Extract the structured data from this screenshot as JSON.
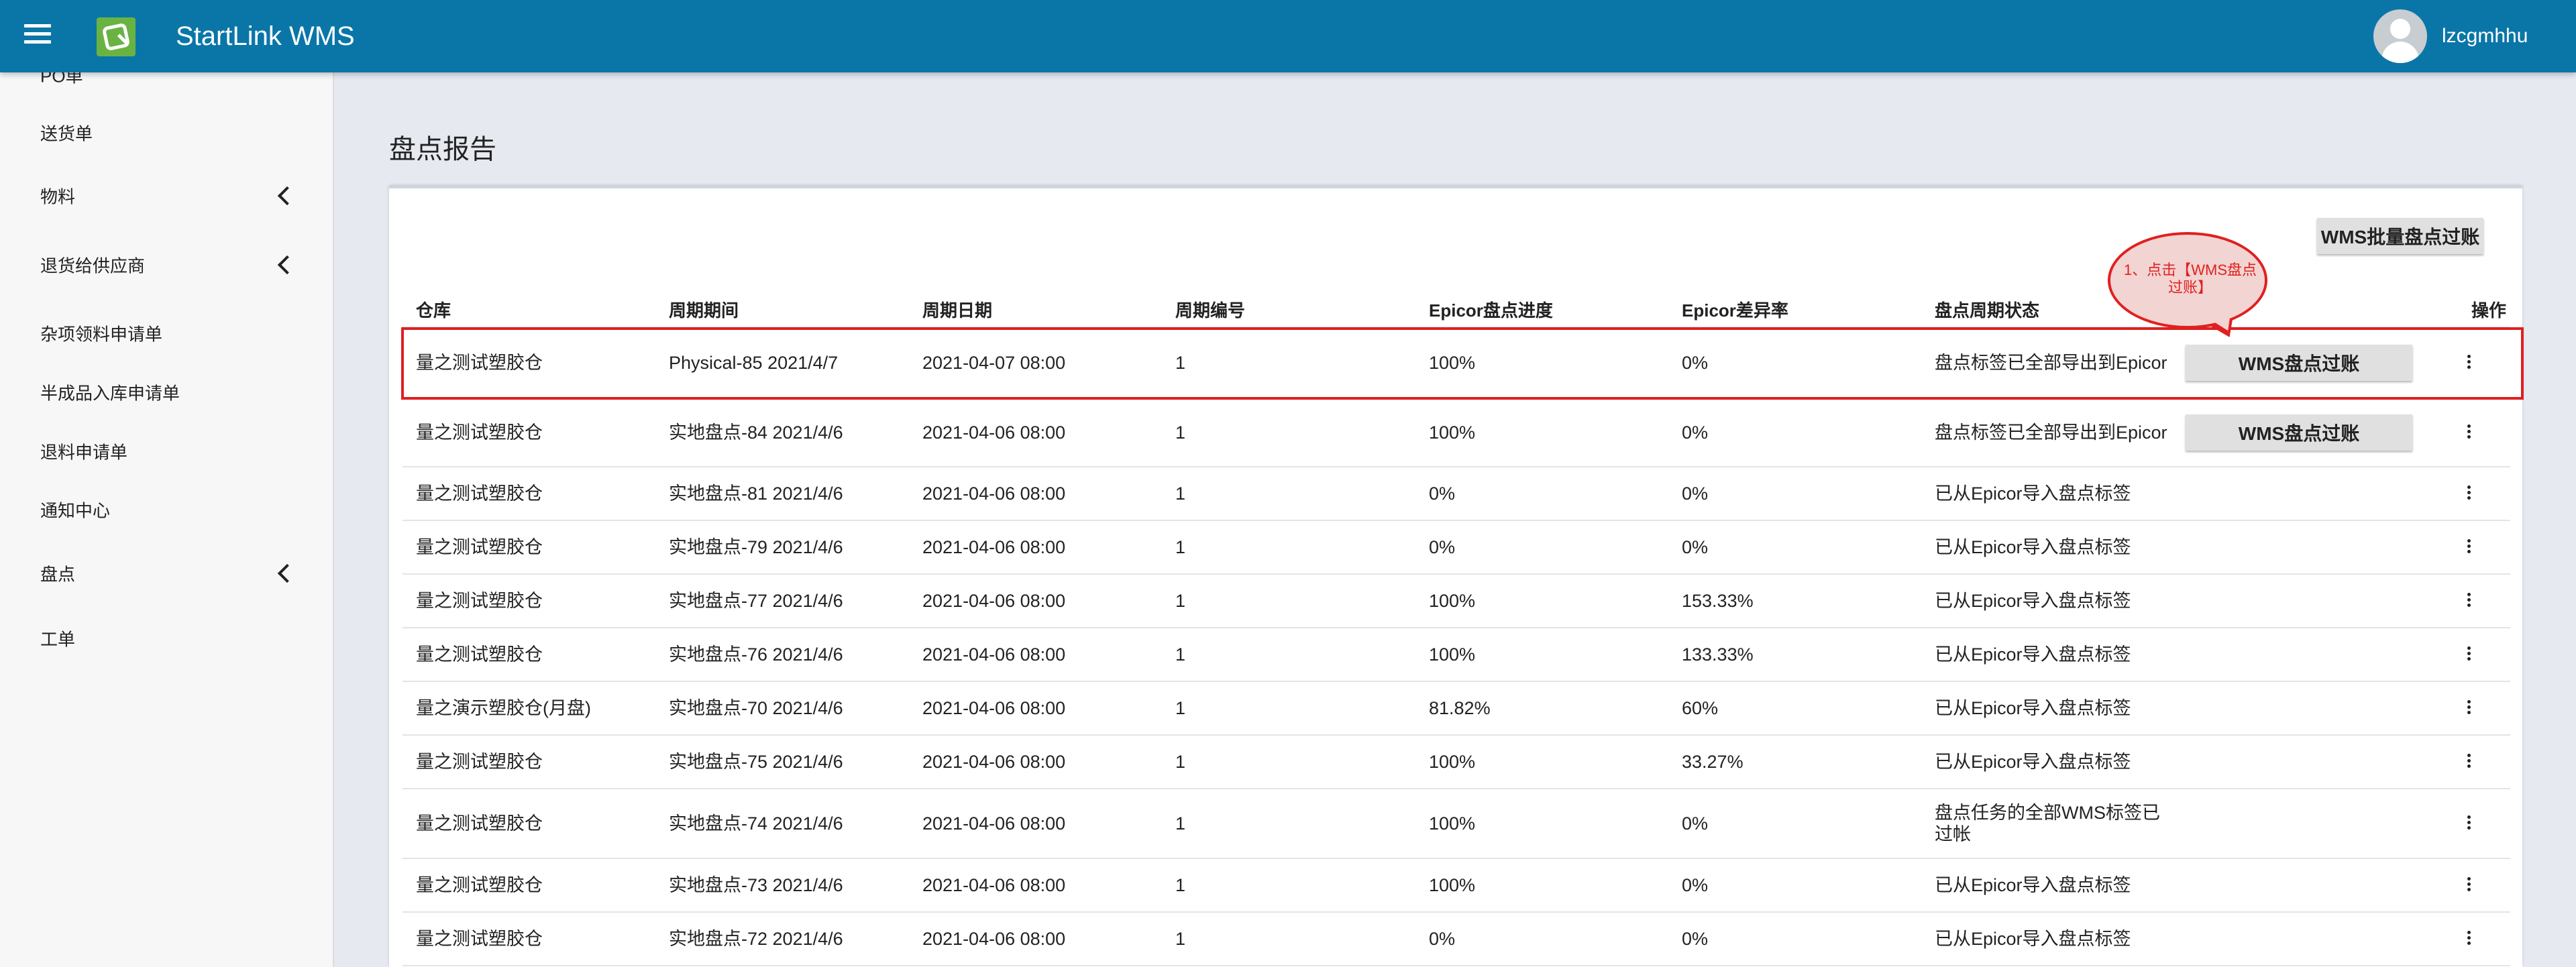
{
  "header": {
    "app_title": "StartLink WMS",
    "username": "lzcgmhhu",
    "brand_color": "#0a76a8",
    "logo_color": "#6ab343"
  },
  "sidebar": {
    "items": [
      {
        "label": "PO单",
        "has_chevron": false
      },
      {
        "label": "送货单",
        "has_chevron": false
      },
      {
        "label": "物料",
        "has_chevron": true
      },
      {
        "label": "退货给供应商",
        "has_chevron": true
      },
      {
        "label": "杂项领料申请单",
        "has_chevron": false
      },
      {
        "label": "半成品入库申请单",
        "has_chevron": false
      },
      {
        "label": "退料申请单",
        "has_chevron": false
      },
      {
        "label": "通知中心",
        "has_chevron": false
      },
      {
        "label": "盘点",
        "has_chevron": true
      },
      {
        "label": "工单",
        "has_chevron": false
      }
    ]
  },
  "main": {
    "page_title": "盘点报告",
    "batch_button": "WMS批量盘点过账",
    "annotation": {
      "text": "1、点击【WMS盘点过账】",
      "color": "#e02020"
    },
    "table": {
      "columns": [
        "仓库",
        "周期期间",
        "周期日期",
        "周期编号",
        "Epicor盘点进度",
        "Epicor差异率",
        "盘点周期状态",
        "操作"
      ],
      "rows": [
        {
          "warehouse": "量之测试塑胶仓",
          "period": "Physical-85 2021/4/7",
          "date": "2021-04-07 08:00",
          "number": "1",
          "progress": "100%",
          "diff": "0%",
          "status": "盘点标签已全部导出到Epicor",
          "action": "WMS盘点过账"
        },
        {
          "warehouse": "量之测试塑胶仓",
          "period": "实地盘点-84 2021/4/6",
          "date": "2021-04-06 08:00",
          "number": "1",
          "progress": "100%",
          "diff": "0%",
          "status": "盘点标签已全部导出到Epicor",
          "action": "WMS盘点过账"
        },
        {
          "warehouse": "量之测试塑胶仓",
          "period": "实地盘点-81 2021/4/6",
          "date": "2021-04-06 08:00",
          "number": "1",
          "progress": "0%",
          "diff": "0%",
          "status": "已从Epicor导入盘点标签",
          "action": ""
        },
        {
          "warehouse": "量之测试塑胶仓",
          "period": "实地盘点-79 2021/4/6",
          "date": "2021-04-06 08:00",
          "number": "1",
          "progress": "0%",
          "diff": "0%",
          "status": "已从Epicor导入盘点标签",
          "action": ""
        },
        {
          "warehouse": "量之测试塑胶仓",
          "period": "实地盘点-77 2021/4/6",
          "date": "2021-04-06 08:00",
          "number": "1",
          "progress": "100%",
          "diff": "153.33%",
          "status": "已从Epicor导入盘点标签",
          "action": ""
        },
        {
          "warehouse": "量之测试塑胶仓",
          "period": "实地盘点-76 2021/4/6",
          "date": "2021-04-06 08:00",
          "number": "1",
          "progress": "100%",
          "diff": "133.33%",
          "status": "已从Epicor导入盘点标签",
          "action": ""
        },
        {
          "warehouse": "量之演示塑胶仓(月盘)",
          "period": "实地盘点-70 2021/4/6",
          "date": "2021-04-06 08:00",
          "number": "1",
          "progress": "81.82%",
          "diff": "60%",
          "status": "已从Epicor导入盘点标签",
          "action": ""
        },
        {
          "warehouse": "量之测试塑胶仓",
          "period": "实地盘点-75 2021/4/6",
          "date": "2021-04-06 08:00",
          "number": "1",
          "progress": "100%",
          "diff": "33.27%",
          "status": "已从Epicor导入盘点标签",
          "action": ""
        },
        {
          "warehouse": "量之测试塑胶仓",
          "period": "实地盘点-74 2021/4/6",
          "date": "2021-04-06 08:00",
          "number": "1",
          "progress": "100%",
          "diff": "0%",
          "status": "盘点任务的全部WMS标签已过帐",
          "action": ""
        },
        {
          "warehouse": "量之测试塑胶仓",
          "period": "实地盘点-73 2021/4/6",
          "date": "2021-04-06 08:00",
          "number": "1",
          "progress": "100%",
          "diff": "0%",
          "status": "已从Epicor导入盘点标签",
          "action": ""
        },
        {
          "warehouse": "量之测试塑胶仓",
          "period": "实地盘点-72 2021/4/6",
          "date": "2021-04-06 08:00",
          "number": "1",
          "progress": "0%",
          "diff": "0%",
          "status": "已从Epicor导入盘点标签",
          "action": ""
        }
      ]
    }
  }
}
